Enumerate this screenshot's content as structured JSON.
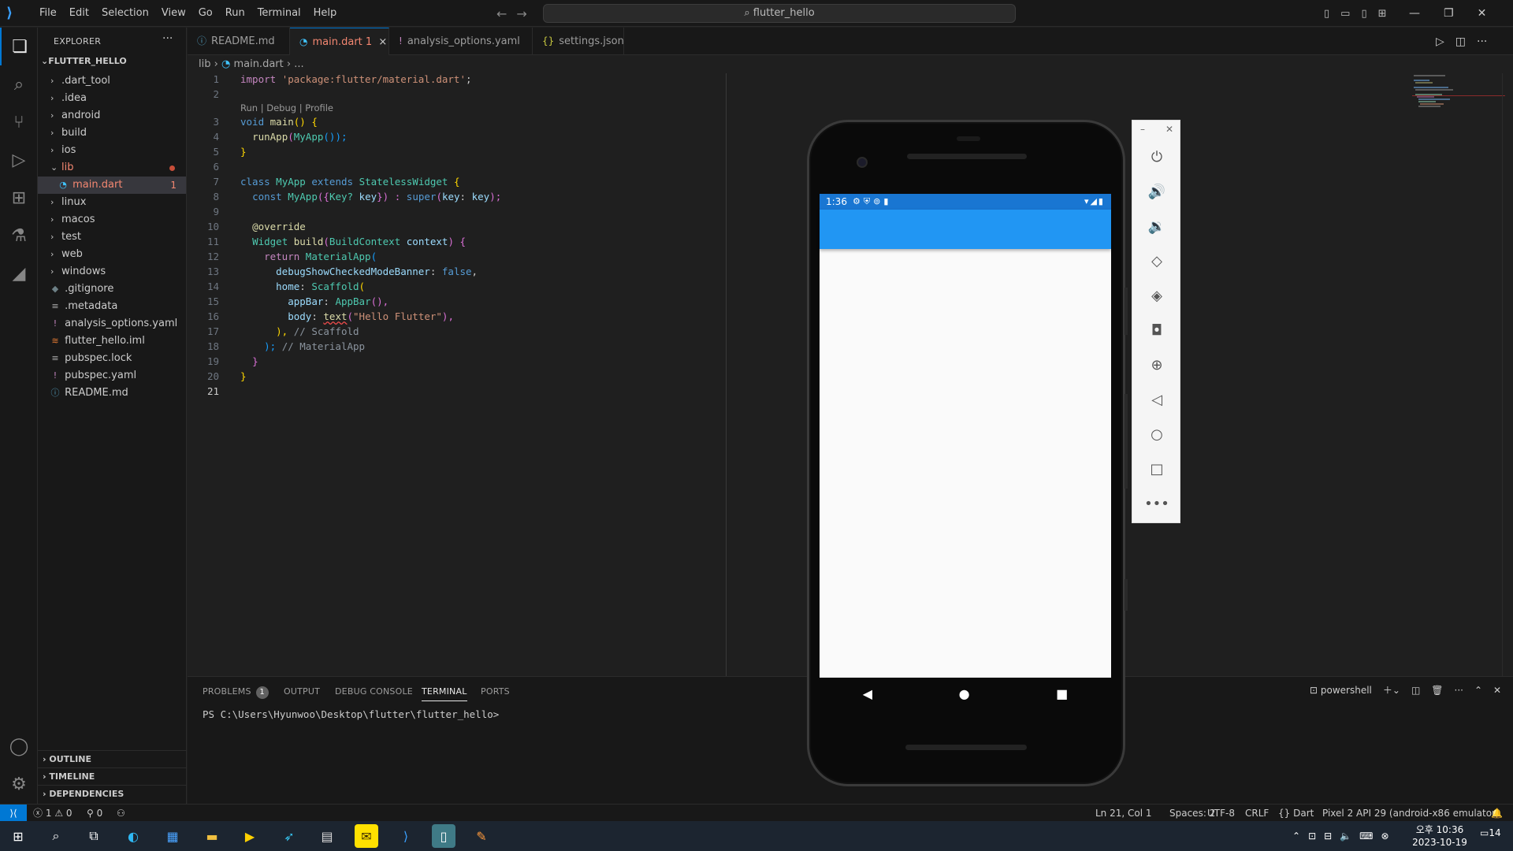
{
  "menu": [
    "File",
    "Edit",
    "Selection",
    "View",
    "Go",
    "Run",
    "Terminal",
    "Help"
  ],
  "search": {
    "text": "flutter_hello"
  },
  "explorer": {
    "title": "EXPLORER",
    "more": "···",
    "root": "FLUTTER_HELLO",
    "items": [
      {
        "label": ".dart_tool",
        "type": "folder"
      },
      {
        "label": ".idea",
        "type": "folder"
      },
      {
        "label": "android",
        "type": "folder"
      },
      {
        "label": "build",
        "type": "folder"
      },
      {
        "label": "ios",
        "type": "folder"
      },
      {
        "label": "lib",
        "type": "folder-open"
      },
      {
        "label": "main.dart",
        "type": "file",
        "badge": "1"
      },
      {
        "label": "linux",
        "type": "folder"
      },
      {
        "label": "macos",
        "type": "folder"
      },
      {
        "label": "test",
        "type": "folder"
      },
      {
        "label": "web",
        "type": "folder"
      },
      {
        "label": "windows",
        "type": "folder"
      },
      {
        "label": ".gitignore",
        "type": "file"
      },
      {
        "label": ".metadata",
        "type": "file"
      },
      {
        "label": "analysis_options.yaml",
        "type": "file"
      },
      {
        "label": "flutter_hello.iml",
        "type": "file"
      },
      {
        "label": "pubspec.lock",
        "type": "file"
      },
      {
        "label": "pubspec.yaml",
        "type": "file"
      },
      {
        "label": "README.md",
        "type": "file"
      }
    ],
    "sections": [
      "OUTLINE",
      "TIMELINE",
      "DEPENDENCIES"
    ]
  },
  "tabs": [
    {
      "label": "README.md",
      "icon": "ⓘ"
    },
    {
      "label": "main.dart",
      "badge": "1",
      "close": "×",
      "icon": "◔"
    },
    {
      "label": "analysis_options.yaml",
      "icon": "!"
    },
    {
      "label": "settings.json",
      "icon": "{}"
    }
  ],
  "breadcrumb": {
    "folder": "lib",
    "file": "main.dart",
    "more": "..."
  },
  "editor": {
    "line_numbers": [
      "1",
      "2",
      "3",
      "4",
      "5",
      "6",
      "7",
      "8",
      "9",
      "10",
      "11",
      "12",
      "13",
      "14",
      "15",
      "16",
      "17",
      "18",
      "19",
      "20",
      "21"
    ],
    "code_lens": "Run | Debug | Profile",
    "code": {
      "l1_kw": "import",
      "l1_str": "'package:flutter/material.dart'",
      "l1_end": ";",
      "l3_kw": "void",
      "l3_fn": "main",
      "l3_rest": "() {",
      "l4_fn": "runApp",
      "l4_arg": "MyApp",
      "l4_rest": "());",
      "l5": "}",
      "l7_kw1": "class",
      "l7_cls": "MyApp",
      "l7_kw2": "extends",
      "l7_base": "StatelessWidget",
      "l7_rest": " {",
      "l8_kw": "const",
      "l8_cls": "MyApp",
      "l8_p1": "({",
      "l8_type": "Key?",
      "l8_var": "key",
      "l8_p2": "}) : ",
      "l8_super": "super",
      "l8_p3": "(",
      "l8_named": "key",
      "l8_p4": ": ",
      "l8_var2": "key",
      "l8_end": ");",
      "l10": "@override",
      "l11_type1": "Widget",
      "l11_fn": "build",
      "l11_type2": "BuildContext",
      "l11_var": "context",
      "l11_end": ") {",
      "l12_kw": "return",
      "l12_cls": "MaterialApp",
      "l12_end": "(",
      "l13_prop": "debugShowCheckedModeBanner",
      "l13_val": "false",
      "l13_end": ",",
      "l14_prop": "home",
      "l14_cls": "Scaffold",
      "l14_end": "(",
      "l15_prop": "appBar",
      "l15_cls": "AppBar",
      "l15_end": "(),",
      "l16_prop": "body",
      "l16_fn": "text",
      "l16_str": "\"Hello Flutter\"",
      "l16_end": "),",
      "l17_code": "),",
      "l17_comment": "// Scaffold",
      "l18_code": ");",
      "l18_comment": "// MaterialApp",
      "l19": "}",
      "l20": "}"
    }
  },
  "panel": {
    "tabs": [
      "PROBLEMS",
      "OUTPUT",
      "DEBUG CONSOLE",
      "TERMINAL",
      "PORTS"
    ],
    "problems_count": "1",
    "shell": "powershell",
    "terminal_line": "PS C:\\Users\\Hyunwoo\\Desktop\\flutter\\flutter_hello>"
  },
  "statusbar": {
    "errors": "1",
    "warnings": "0",
    "ports": "0",
    "position": "Ln 21, Col 1",
    "spaces": "Spaces: 2",
    "encoding": "UTF-8",
    "eol": "CRLF",
    "language": "Dart",
    "device": "Pixel 2 API 29 (android-x86 emulator)"
  },
  "emulator": {
    "time": "1:36",
    "appbar_color": "#2196f3",
    "statusbar_color": "#1976d2"
  },
  "taskbar": {
    "clock_ampm": "오후 10:36",
    "clock_date": "2023-10-19",
    "notifications": "14"
  }
}
